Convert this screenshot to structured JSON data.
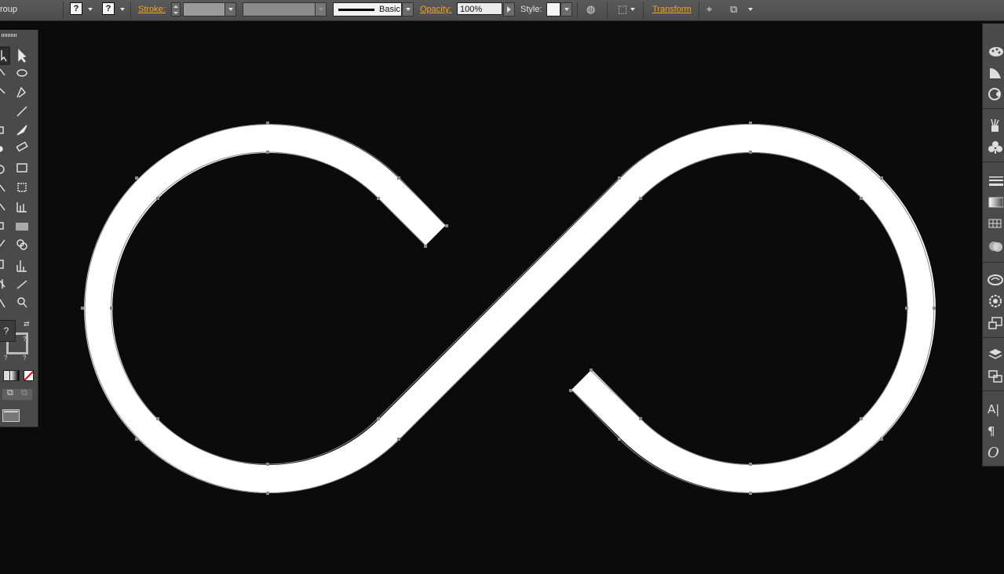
{
  "control_bar": {
    "selection_label": "roup",
    "fill_value": "?",
    "stroke_value": "?",
    "stroke_label": "Stroke:",
    "brush_label": "Basic",
    "opacity_label": "Opacity:",
    "opacity_value": "100%",
    "style_label": "Style:",
    "transform_label": "Transform"
  },
  "tools_panel": {
    "fill_value": "?",
    "stroke_small_1": "?",
    "stroke_small_2": "?",
    "stroke_small_3": "?"
  },
  "right_dock": {
    "character_glyph": "A|",
    "paragraph_glyph": "¶",
    "opentype_glyph": "O"
  },
  "artwork": {
    "shape": "infinity-symbol",
    "stroke_color": "#ffffff",
    "background_color": "#0b0b0b"
  },
  "colors": {
    "accent_link": "#f5a623",
    "panel": "#4a4a4a",
    "canvas": "#0b0b0b"
  }
}
